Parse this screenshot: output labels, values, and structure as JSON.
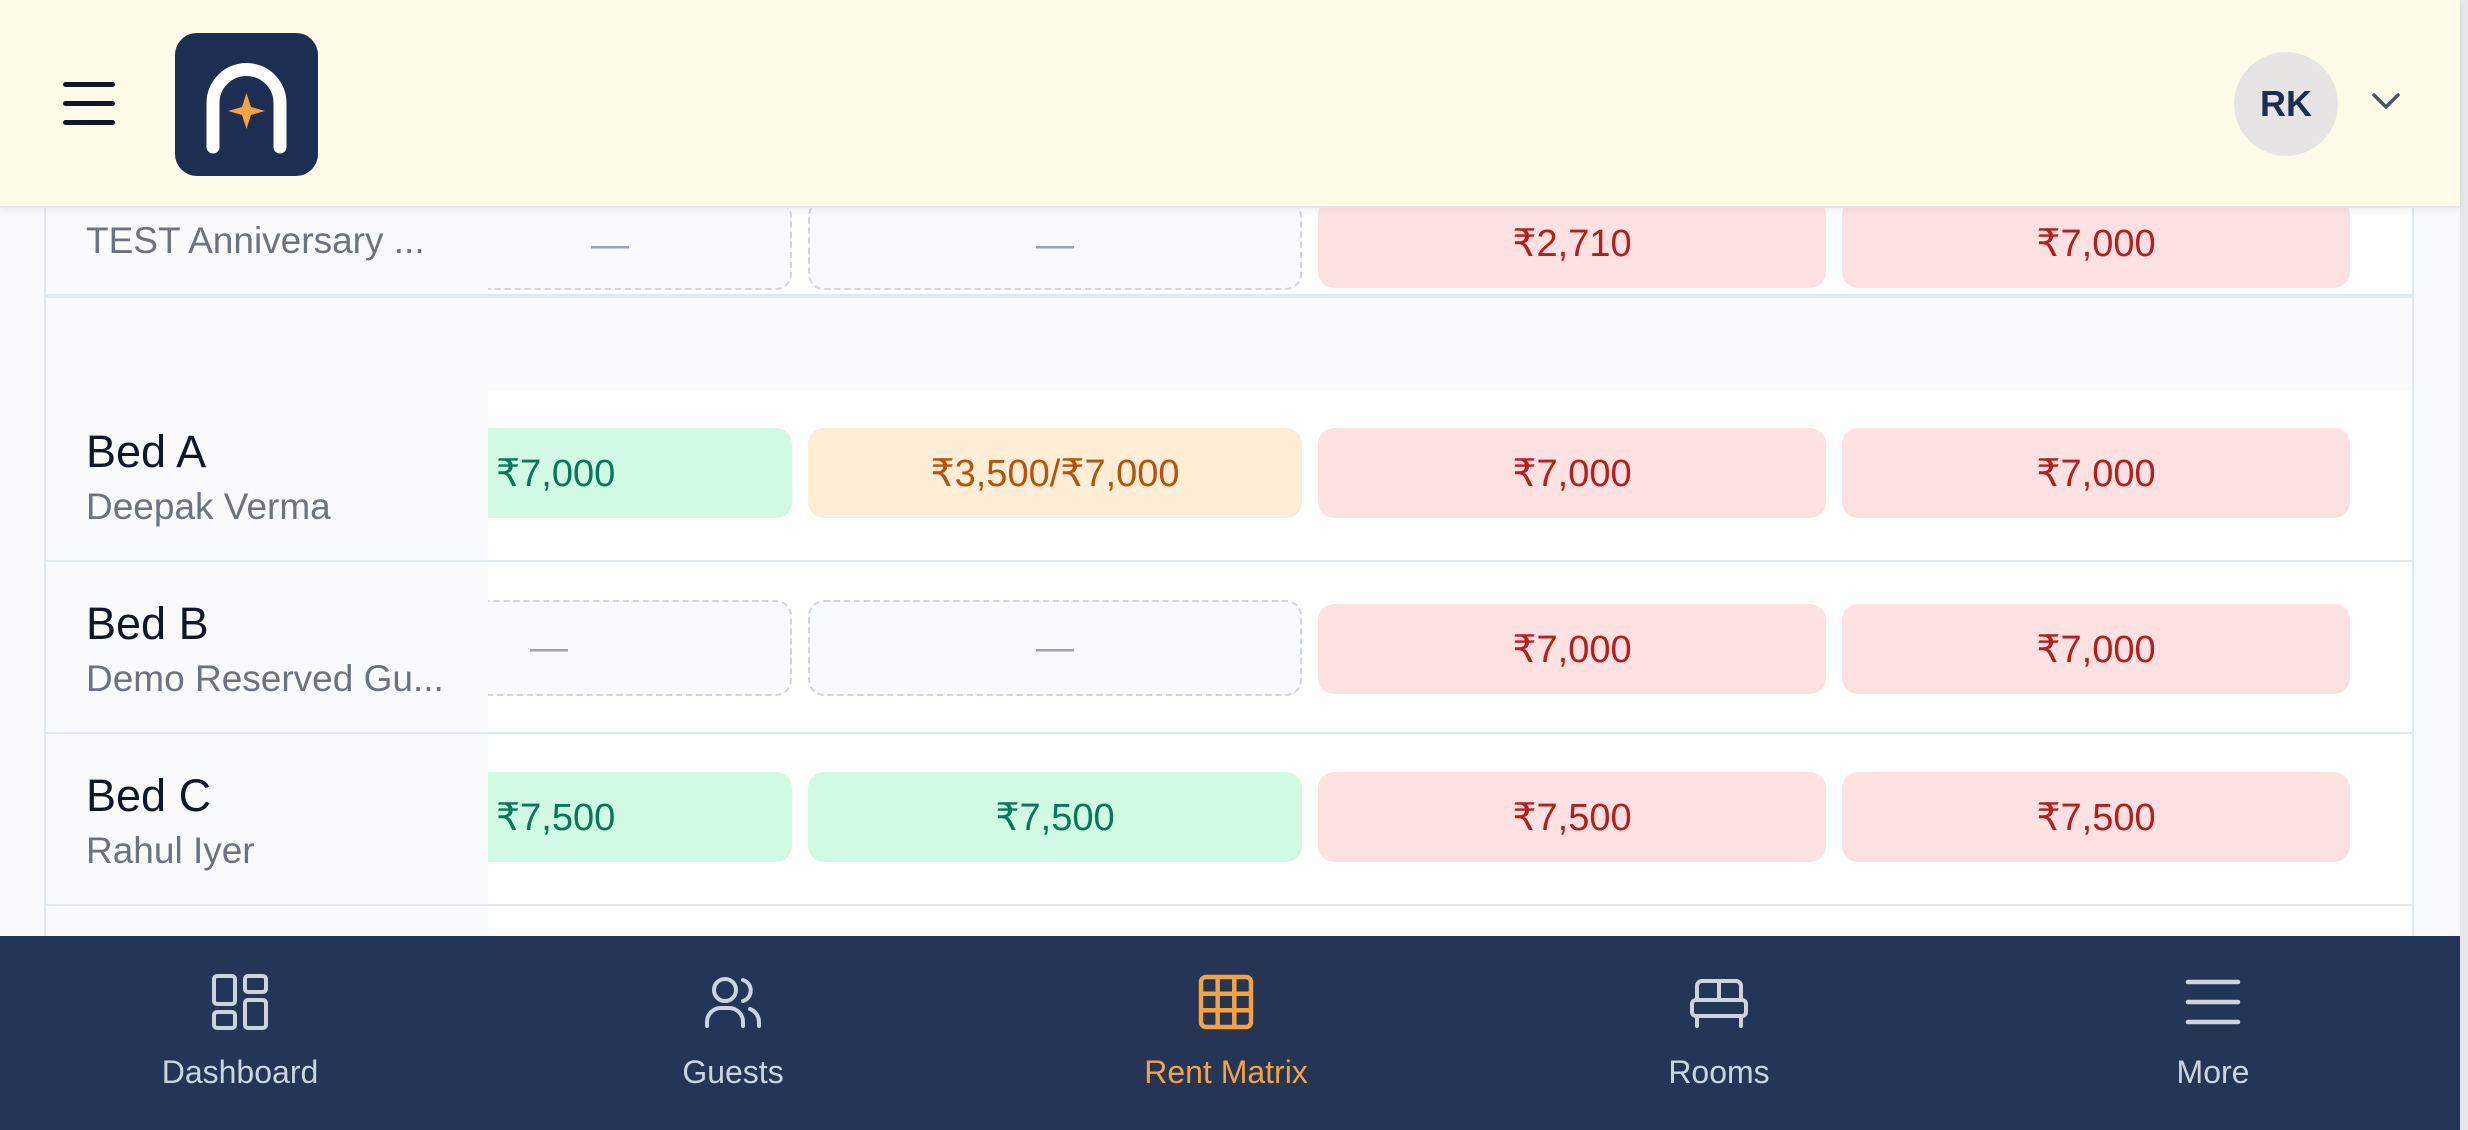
{
  "header": {
    "menu_icon": "hamburger-menu-icon",
    "logo_icon": "arch-star-logo",
    "avatar_initials": "RK",
    "avatar_dropdown_icon": "chevron-down-icon"
  },
  "colors": {
    "header_bg": "#fefce8",
    "brand_navy": "#1e2d52",
    "accent": "#f4a340",
    "paid": "#d1fae5",
    "partial": "#ffedd5",
    "due": "#fee2e2"
  },
  "rows": [
    {
      "guest": "TEST Anniversary ...",
      "cells": [
        "—",
        "—",
        "₹2,710",
        "₹7,000"
      ]
    },
    {
      "bed": "Bed A",
      "guest": "Deepak Verma",
      "cells": [
        "₹7,000",
        "₹3,500/₹7,000",
        "₹7,000",
        "₹7,000"
      ]
    },
    {
      "bed": "Bed B",
      "guest": "Demo Reserved Gu...",
      "cells": [
        "—",
        "—",
        "₹7,000",
        "₹7,000"
      ]
    },
    {
      "bed": "Bed C",
      "guest": "Rahul Iyer",
      "cells": [
        "₹7,500",
        "₹7,500",
        "₹7,500",
        "₹7,500"
      ]
    }
  ],
  "nav": [
    {
      "label": "Dashboard",
      "icon": "dashboard-grid-icon"
    },
    {
      "label": "Guests",
      "icon": "users-icon"
    },
    {
      "label": "Rent Matrix",
      "icon": "table-grid-icon",
      "active": true
    },
    {
      "label": "Rooms",
      "icon": "bed-icon"
    },
    {
      "label": "More",
      "icon": "menu-lines-icon"
    }
  ]
}
